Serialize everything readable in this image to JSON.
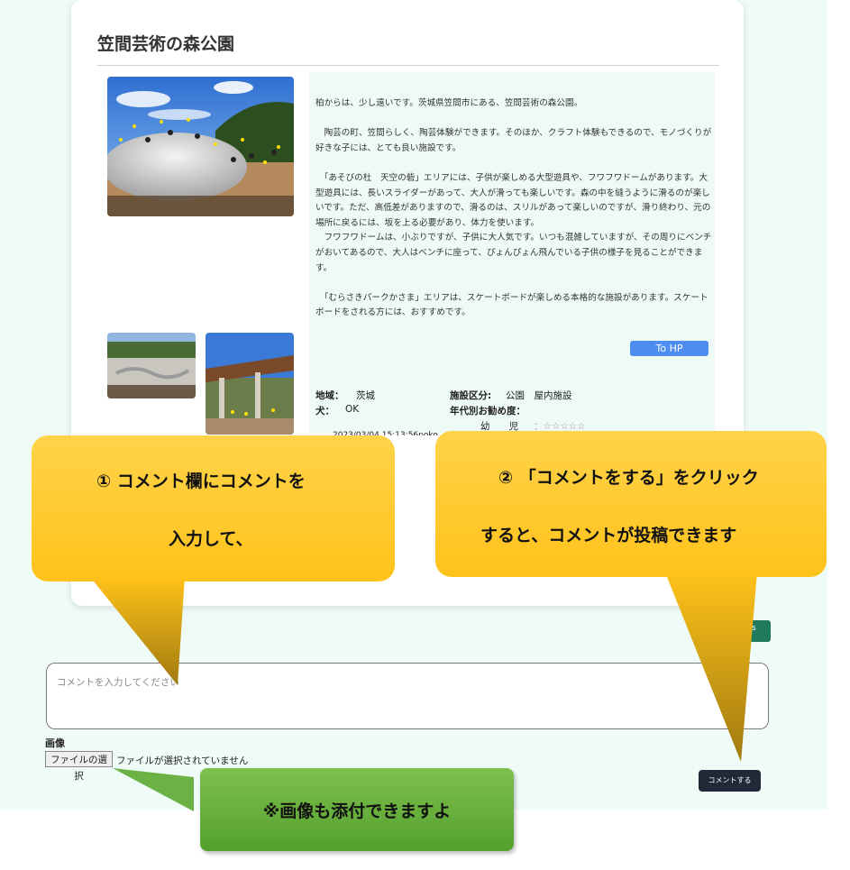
{
  "park": {
    "title": "笠間芸術の森公園",
    "description": "柏からは、少し遠いです。茨城県笠間市にある、笠間芸術の森公園。\n\n　陶芸の町、笠間らしく、陶芸体験ができます。そのほか、クラフト体験もできるので、モノづくりが好きな子には、とても良い施設です。\n\n　「あそびの杜　天空の砦」エリアには、子供が楽しめる大型遊具や、フワフワドームがあります。大型遊具には、長いスライダーがあって、大人が滑っても楽しいです。森の中を縫うように滑るのが楽しいです。ただ、高低差がありますので、滑るのは、スリルがあって楽しいのですが、滑り終わり、元の場所に戻るには、坂を上る必要があり、体力を使います。\n　フワフワドームは、小ぶりですが、子供に大人気です。いつも混雑していますが、その周りにベンチがおいてあるので、大人はベンチに座って、ぴょんぴょん飛んでいる子供の様子を見ることができます。\n\n　「むらさきパークかさま」エリアは、スケートボードが楽しめる本格的な施設があります。スケートボードをされる方には、おすすめです。",
    "hp_button": "To HP",
    "region_label": "地域：",
    "region_value": "茨城",
    "dog_label": "犬：",
    "dog_value": "OK",
    "facility_label": "施設区分:",
    "facility_value": "公園　屋内施設",
    "age_label": "年代別お勧め度：",
    "age_row_label": "幼　　児",
    "age_row_stars": "：☆☆☆☆☆",
    "timestamp": "2023/03/04 15:13:56poko"
  },
  "callouts": {
    "one_line1": "① コメント欄にコメントを",
    "one_line2": "入力して、",
    "two_line1": "② 「コメントをする」をクリック",
    "two_line2": "すると、コメントが投稿できます",
    "image_note": "※画像も添付できますよ"
  },
  "comment_form": {
    "placeholder": "コメントを入力してください",
    "image_label": "画像",
    "file_button": "ファイルの選択",
    "file_status": "ファイルが選択されていません",
    "submit": "コメントする"
  },
  "colors": {
    "callout_yellow": "#ffc21a",
    "callout_green": "#54a02c",
    "hp_button": "#4e8df0",
    "submit_button": "#1f2937",
    "page_bg": "#effbf7"
  }
}
